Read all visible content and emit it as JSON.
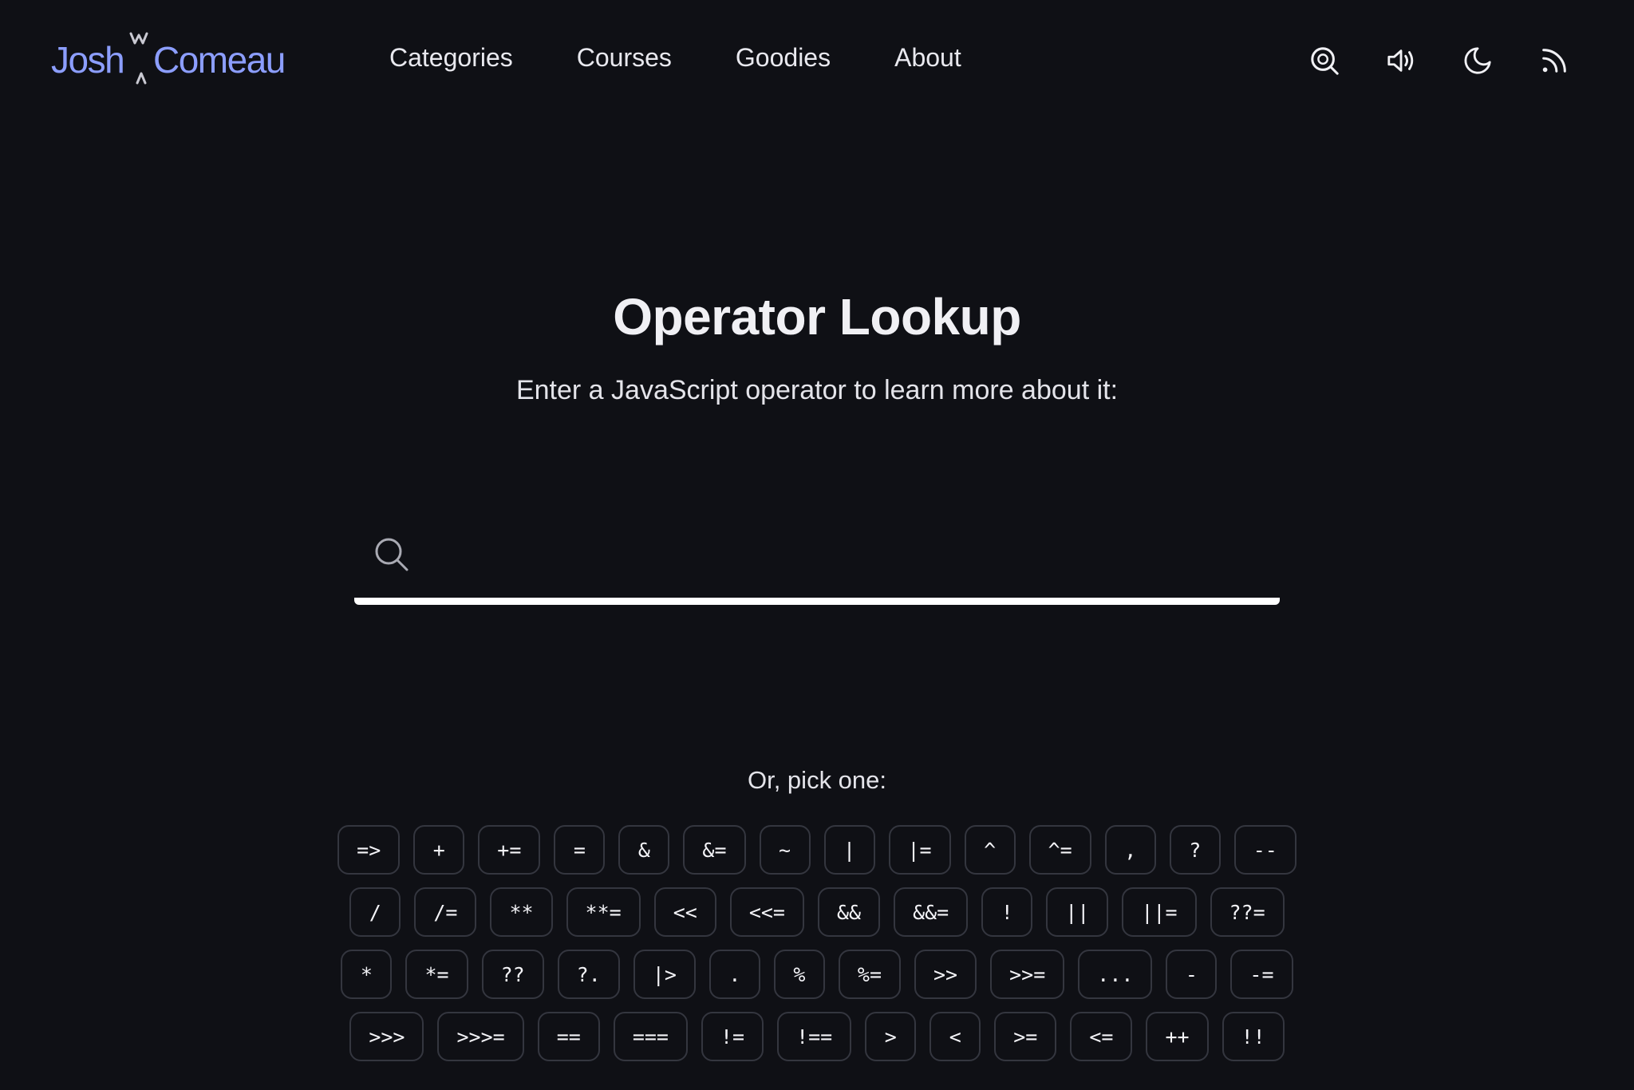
{
  "header": {
    "logo": {
      "first": "Josh",
      "last": "Comeau"
    },
    "nav": [
      {
        "label": "Categories"
      },
      {
        "label": "Courses"
      },
      {
        "label": "Goodies"
      },
      {
        "label": "About"
      }
    ],
    "actions": [
      {
        "icon": "search-icon"
      },
      {
        "icon": "sound-icon"
      },
      {
        "icon": "moon-icon"
      },
      {
        "icon": "rss-icon"
      }
    ]
  },
  "main": {
    "title": "Operator Lookup",
    "subtitle": "Enter a JavaScript operator to learn more about it:",
    "search": {
      "value": "",
      "placeholder": ""
    },
    "pick_label": "Or, pick one:",
    "operator_rows": [
      [
        "=>",
        "+",
        "+=",
        "=",
        "&",
        "&=",
        "~",
        "|",
        "|=",
        "^",
        "^=",
        ",",
        "?",
        "--"
      ],
      [
        "/",
        "/=",
        "**",
        "**=",
        "<<",
        "<<=",
        "&&",
        "&&=",
        "!",
        "||",
        "||=",
        "??="
      ],
      [
        "*",
        "*=",
        "??",
        "?.",
        "|>",
        ".",
        "%",
        "%=",
        ">>",
        ">>=",
        "...",
        "-",
        "-="
      ],
      [
        ">>>",
        ">>>=",
        "==",
        "===",
        "!=",
        "!==",
        ">",
        "<",
        ">=",
        "<=",
        "++",
        "!!"
      ]
    ]
  },
  "colors": {
    "background": "#0f1015",
    "logo": "#8c9eff",
    "text": "#f0f0f4",
    "button_border": "#34363f"
  }
}
